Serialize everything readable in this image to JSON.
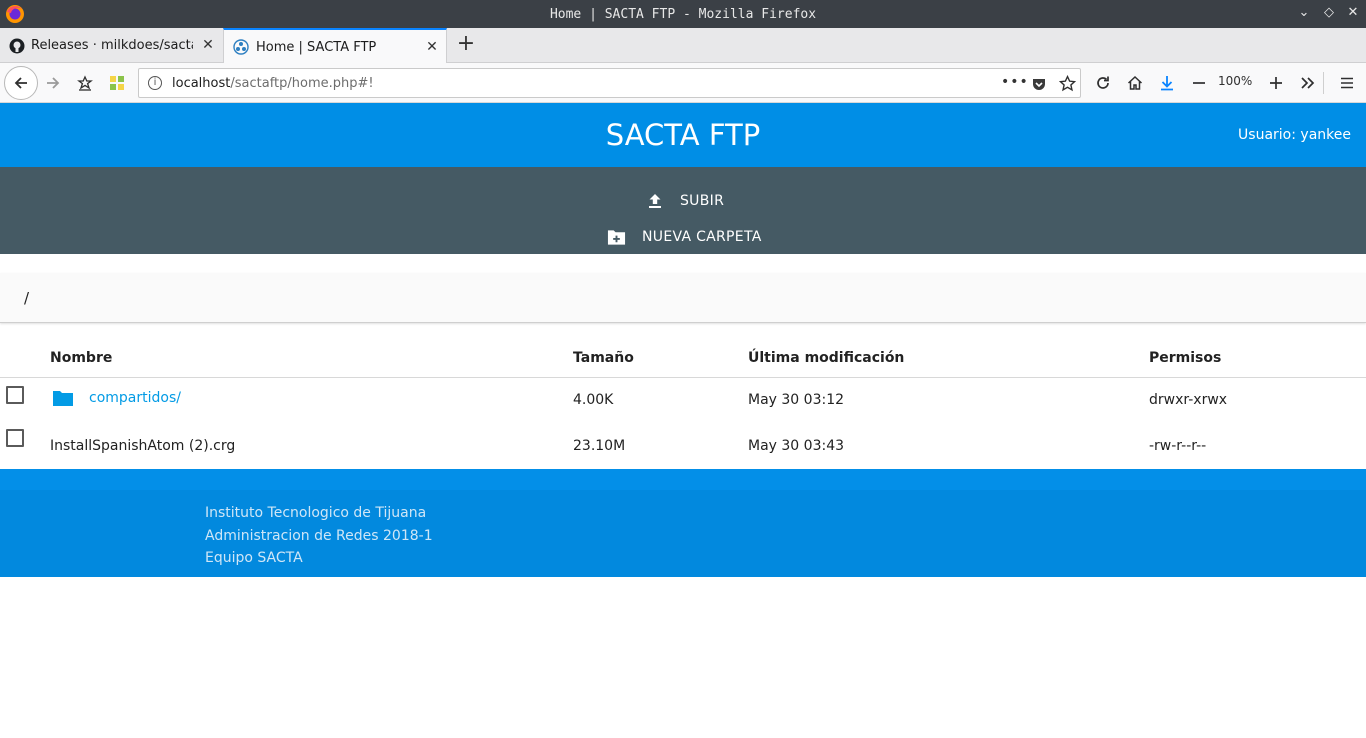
{
  "window": {
    "title": "Home | SACTA FTP - Mozilla Firefox"
  },
  "tabs": [
    {
      "label": "Releases · milkdoes/sactaFTP",
      "icon": "github-icon",
      "active": false
    },
    {
      "label": "Home | SACTA FTP",
      "icon": "sacta-favicon-icon",
      "active": true
    }
  ],
  "navbar": {
    "url_host": "localhost",
    "url_path": "/sactaftp/home.php#!",
    "zoom": "100%"
  },
  "app": {
    "title": "SACTA FTP",
    "user": "Usuario: yankee",
    "actions": [
      {
        "label": "SUBIR",
        "icon": "upload-icon"
      },
      {
        "label": "NUEVA CARPETA",
        "icon": "create-folder-icon"
      }
    ],
    "breadcrumb": "/",
    "table": {
      "headers": [
        "Nombre",
        "Tamaño",
        "Última modificación",
        "Permisos"
      ],
      "rows": [
        {
          "name": "compartidos/",
          "size": "4.00K",
          "modified": "May 30 03:12",
          "perms": "drwxr-xrwx",
          "is_folder": true
        },
        {
          "name": "InstallSpanishAtom (2).crg",
          "size": "23.10M",
          "modified": "May 30 03:43",
          "perms": "-rw-r--r--",
          "is_folder": false
        }
      ]
    },
    "footer": {
      "lines": [
        "Instituto Tecnologico de Tijuana",
        "Administracion de Redes 2018-1",
        "Equipo SACTA"
      ]
    }
  },
  "colors": {
    "header_blue": "#008ee6",
    "toolbar_slate": "#455a64",
    "link_blue": "#039be5",
    "footer_blue": "#0289de"
  }
}
